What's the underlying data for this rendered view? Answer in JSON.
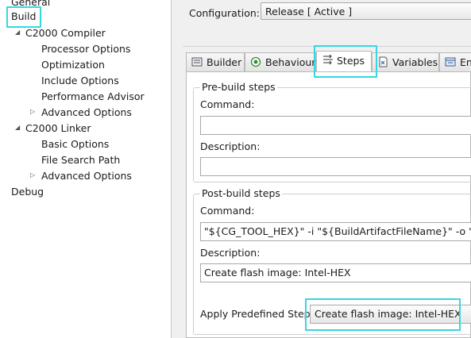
{
  "tree": {
    "items": [
      {
        "label": "General"
      },
      {
        "label": "Build"
      },
      {
        "label": "C2000 Compiler",
        "expander": "◢"
      },
      {
        "label": "Processor Options"
      },
      {
        "label": "Optimization"
      },
      {
        "label": "Include Options"
      },
      {
        "label": "Performance Advisor"
      },
      {
        "label": "Advanced Options",
        "expander": "▷"
      },
      {
        "label": "C2000 Linker",
        "expander": "◢"
      },
      {
        "label": "Basic Options"
      },
      {
        "label": "File Search Path"
      },
      {
        "label": "Advanced Options",
        "expander": "▷"
      },
      {
        "label": "Debug"
      }
    ]
  },
  "config": {
    "label": "Configuration:",
    "value": "Release  [ Active ]"
  },
  "tabs": [
    {
      "label": "Builder",
      "icon": "builder-icon"
    },
    {
      "label": "Behaviour",
      "icon": "behaviour-icon"
    },
    {
      "label": "Steps",
      "icon": "steps-icon",
      "active": true
    },
    {
      "label": "Variables",
      "icon": "variables-icon"
    },
    {
      "label": "En",
      "icon": "environment-icon"
    }
  ],
  "prebuild": {
    "title": "Pre-build steps",
    "command_label": "Command:",
    "command_value": "",
    "description_label": "Description:",
    "description_value": ""
  },
  "postbuild": {
    "title": "Post-build steps",
    "command_label": "Command:",
    "command_value": "\"${CG_TOOL_HEX}\" -i \"${BuildArtifactFileName}\" -o \"${Build",
    "description_label": "Description:",
    "description_value": "Create flash image: Intel-HEX",
    "predefined_label": "Apply Predefined Step:",
    "predefined_value": "Create flash image: Intel-HEX"
  },
  "colors": {
    "highlight": "#35d6e2",
    "panel_bg": "#f0f0f0"
  }
}
